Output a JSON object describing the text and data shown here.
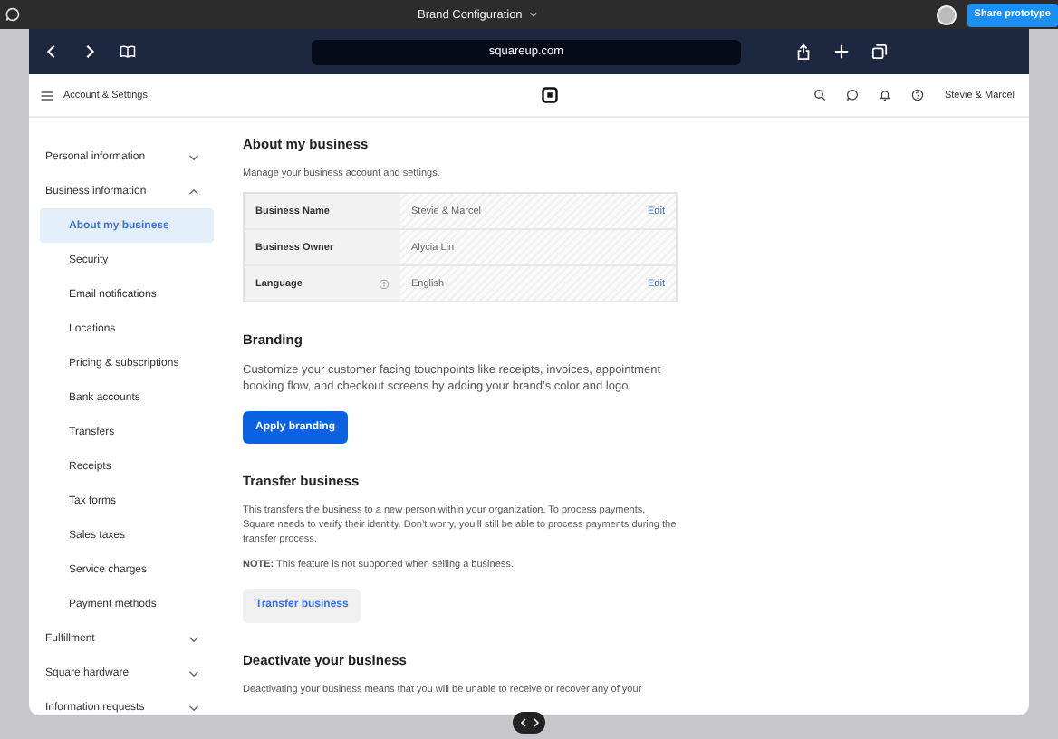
{
  "prototype_bar": {
    "title": "Brand Configuration",
    "share_button": "Share prototype"
  },
  "browser": {
    "url": "squareup.com"
  },
  "app_header": {
    "title": "Account & Settings",
    "account": "Stevie & Marcel"
  },
  "sidebar": {
    "items": [
      {
        "label": "Personal information",
        "expanded": false
      },
      {
        "label": "Business information",
        "expanded": true,
        "children": [
          {
            "label": "About my business",
            "selected": true
          },
          {
            "label": "Security",
            "selected": false
          },
          {
            "label": "Email notifications",
            "selected": false
          },
          {
            "label": "Locations",
            "selected": false
          },
          {
            "label": "Pricing & subscriptions",
            "selected": false
          },
          {
            "label": "Bank accounts",
            "selected": false
          },
          {
            "label": "Transfers",
            "selected": false
          },
          {
            "label": "Receipts",
            "selected": false
          },
          {
            "label": "Tax forms",
            "selected": false
          },
          {
            "label": "Sales taxes",
            "selected": false
          },
          {
            "label": "Service charges",
            "selected": false
          },
          {
            "label": "Payment methods",
            "selected": false
          }
        ]
      },
      {
        "label": "Fulfillment",
        "expanded": false
      },
      {
        "label": "Square hardware",
        "expanded": false
      },
      {
        "label": "Information requests",
        "expanded": false
      }
    ]
  },
  "sections": [
    {
      "title": "About my business",
      "paragraphs": [
        "Manage your business account and settings."
      ],
      "rows": [
        {
          "label": "Business Name",
          "info": false,
          "value": "Stevie & Marcel",
          "action": "Edit"
        },
        {
          "label": "Business Owner",
          "info": false,
          "value": "Alycia Lin"
        },
        {
          "label": "Language",
          "info": true,
          "value": "English",
          "action": "Edit"
        }
      ]
    },
    {
      "title": "Branding",
      "large_text": true,
      "paragraphs": [
        "Customize your customer facing touchpoints like receipts, invoices, appointment booking flow, and checkout screens by adding your brand’s color and logo."
      ],
      "button": {
        "label": "Apply branding",
        "kind": "primary"
      }
    },
    {
      "title": "Transfer business",
      "paragraphs": [
        "This transfers the business to a new person within your organization. To process payments, Square needs to verify their identity. Don’t worry, you’ll still be able to process payments during the transfer process.",
        "**NOTE:** This feature is not supported when selling a business."
      ],
      "button": {
        "label": "Transfer business",
        "kind": "secondary"
      }
    },
    {
      "title": "Deactivate your business",
      "paragraphs": [
        "Deactivating your business means that you will be unable to receive or recover any of your"
      ]
    }
  ]
}
